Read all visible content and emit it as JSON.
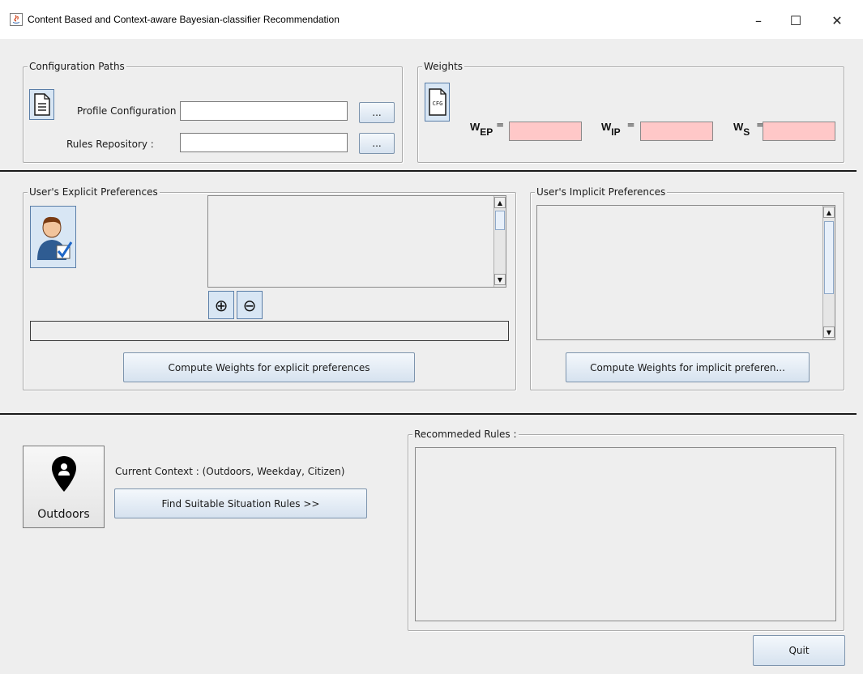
{
  "window": {
    "title": "Content Based and Context-aware Bayesian-classifier Recommendation",
    "minimize": "–",
    "maximize": "☐",
    "close": "✕"
  },
  "config": {
    "legend": "Configuration Paths",
    "profile_label": "Profile Configuration :",
    "profile_value": "",
    "rules_label": "Rules Repository  :",
    "rules_value": "",
    "browse_label": "..."
  },
  "weights": {
    "legend": "Weights",
    "icon_text": "CFG",
    "w_main": "W",
    "ep_sub": "EP",
    "ip_sub": "IP",
    "s_sub": "S",
    "eq": "="
  },
  "explicit": {
    "legend": "User's Explicit Preferences",
    "add_symbol": "⊕",
    "remove_symbol": "⊖",
    "compute_label": "Compute Weights for explicit preferences"
  },
  "implicit": {
    "legend": "User's Implicit Preferences",
    "compute_label": "Compute Weights for implicit preferen..."
  },
  "context": {
    "location_label": "Outdoors",
    "current_context": "Current Context : (Outdoors,  Weekday, Citizen)",
    "find_label": "Find Suitable Situation Rules  >>"
  },
  "recommended": {
    "legend": "Recommeded Rules :"
  },
  "quit_label": "Quit"
}
